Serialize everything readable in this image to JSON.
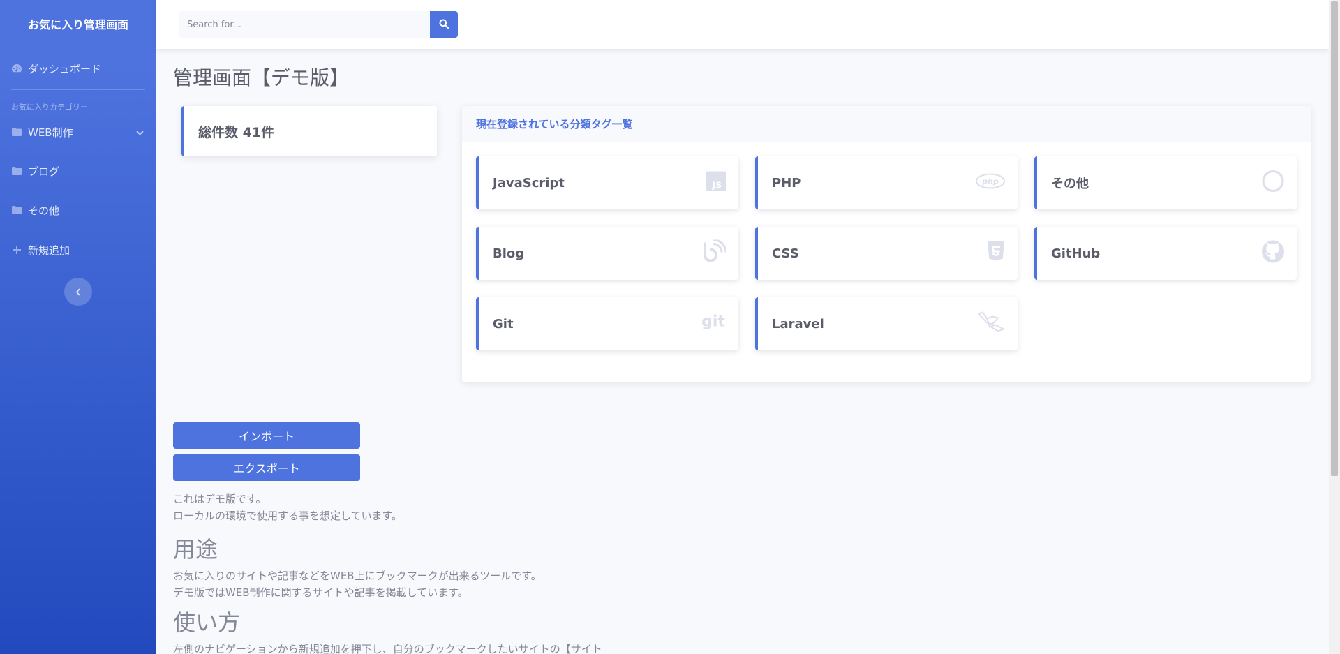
{
  "sidebar": {
    "brand": "お気に入り管理画面",
    "dashboard": "ダッシュボード",
    "heading": "お気に入りカテゴリー",
    "items": [
      {
        "label": "WEB制作",
        "icon": "folder-icon"
      },
      {
        "label": "ブログ",
        "icon": "folder-icon"
      },
      {
        "label": "その他",
        "icon": "folder-icon"
      }
    ],
    "add": "新規追加"
  },
  "topbar": {
    "search_placeholder": "Search for..."
  },
  "main": {
    "title": "管理画面【デモ版】",
    "total": "総件数 41件",
    "tag_panel_title": "現在登録されている分類タグ一覧",
    "tags": [
      {
        "label": "JavaScript",
        "icon": "js-icon"
      },
      {
        "label": "PHP",
        "icon": "php-icon"
      },
      {
        "label": "その他",
        "icon": "circle-icon"
      },
      {
        "label": "Blog",
        "icon": "blog-icon"
      },
      {
        "label": "CSS",
        "icon": "css3-icon"
      },
      {
        "label": "GitHub",
        "icon": "github-icon"
      },
      {
        "label": "Git",
        "icon": "git-icon"
      },
      {
        "label": "Laravel",
        "icon": "laravel-icon"
      }
    ],
    "import_label": "インポート",
    "export_label": "エクスポート",
    "intro_line1": "これはデモ版です。",
    "intro_line2": "ローカルの環境で使用する事を想定しています。",
    "usage_heading": "用途",
    "usage_line1": "お気に入りのサイトや記事などをWEB上にブックマークが出来るツールです。",
    "usage_line2": "デモ版ではWEB制作に関するサイトや記事を掲載しています。",
    "howto_heading": "使い方",
    "howto_line1": "左側のナビゲーションから新規追加を押下し、自分のブックマークしたいサイトの【サイト"
  },
  "colors": {
    "primary": "#4e73df",
    "sidebar_gradient_end": "#224abe",
    "text": "#858796",
    "heading_text": "#5a5c69",
    "background": "#f8f9fc"
  }
}
